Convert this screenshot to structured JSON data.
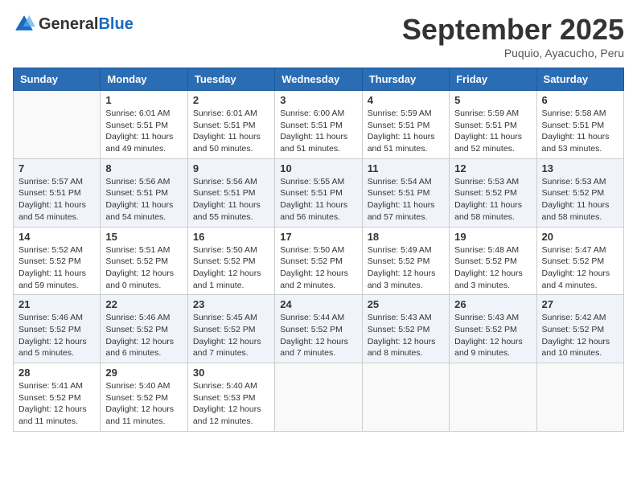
{
  "logo": {
    "general": "General",
    "blue": "Blue"
  },
  "title": "September 2025",
  "location": "Puquio, Ayacucho, Peru",
  "days_of_week": [
    "Sunday",
    "Monday",
    "Tuesday",
    "Wednesday",
    "Thursday",
    "Friday",
    "Saturday"
  ],
  "weeks": [
    [
      {
        "day": "",
        "sunrise": "",
        "sunset": "",
        "daylight": ""
      },
      {
        "day": "1",
        "sunrise": "Sunrise: 6:01 AM",
        "sunset": "Sunset: 5:51 PM",
        "daylight": "Daylight: 11 hours and 49 minutes."
      },
      {
        "day": "2",
        "sunrise": "Sunrise: 6:01 AM",
        "sunset": "Sunset: 5:51 PM",
        "daylight": "Daylight: 11 hours and 50 minutes."
      },
      {
        "day": "3",
        "sunrise": "Sunrise: 6:00 AM",
        "sunset": "Sunset: 5:51 PM",
        "daylight": "Daylight: 11 hours and 51 minutes."
      },
      {
        "day": "4",
        "sunrise": "Sunrise: 5:59 AM",
        "sunset": "Sunset: 5:51 PM",
        "daylight": "Daylight: 11 hours and 51 minutes."
      },
      {
        "day": "5",
        "sunrise": "Sunrise: 5:59 AM",
        "sunset": "Sunset: 5:51 PM",
        "daylight": "Daylight: 11 hours and 52 minutes."
      },
      {
        "day": "6",
        "sunrise": "Sunrise: 5:58 AM",
        "sunset": "Sunset: 5:51 PM",
        "daylight": "Daylight: 11 hours and 53 minutes."
      }
    ],
    [
      {
        "day": "7",
        "sunrise": "Sunrise: 5:57 AM",
        "sunset": "Sunset: 5:51 PM",
        "daylight": "Daylight: 11 hours and 54 minutes."
      },
      {
        "day": "8",
        "sunrise": "Sunrise: 5:56 AM",
        "sunset": "Sunset: 5:51 PM",
        "daylight": "Daylight: 11 hours and 54 minutes."
      },
      {
        "day": "9",
        "sunrise": "Sunrise: 5:56 AM",
        "sunset": "Sunset: 5:51 PM",
        "daylight": "Daylight: 11 hours and 55 minutes."
      },
      {
        "day": "10",
        "sunrise": "Sunrise: 5:55 AM",
        "sunset": "Sunset: 5:51 PM",
        "daylight": "Daylight: 11 hours and 56 minutes."
      },
      {
        "day": "11",
        "sunrise": "Sunrise: 5:54 AM",
        "sunset": "Sunset: 5:51 PM",
        "daylight": "Daylight: 11 hours and 57 minutes."
      },
      {
        "day": "12",
        "sunrise": "Sunrise: 5:53 AM",
        "sunset": "Sunset: 5:52 PM",
        "daylight": "Daylight: 11 hours and 58 minutes."
      },
      {
        "day": "13",
        "sunrise": "Sunrise: 5:53 AM",
        "sunset": "Sunset: 5:52 PM",
        "daylight": "Daylight: 11 hours and 58 minutes."
      }
    ],
    [
      {
        "day": "14",
        "sunrise": "Sunrise: 5:52 AM",
        "sunset": "Sunset: 5:52 PM",
        "daylight": "Daylight: 11 hours and 59 minutes."
      },
      {
        "day": "15",
        "sunrise": "Sunrise: 5:51 AM",
        "sunset": "Sunset: 5:52 PM",
        "daylight": "Daylight: 12 hours and 0 minutes."
      },
      {
        "day": "16",
        "sunrise": "Sunrise: 5:50 AM",
        "sunset": "Sunset: 5:52 PM",
        "daylight": "Daylight: 12 hours and 1 minute."
      },
      {
        "day": "17",
        "sunrise": "Sunrise: 5:50 AM",
        "sunset": "Sunset: 5:52 PM",
        "daylight": "Daylight: 12 hours and 2 minutes."
      },
      {
        "day": "18",
        "sunrise": "Sunrise: 5:49 AM",
        "sunset": "Sunset: 5:52 PM",
        "daylight": "Daylight: 12 hours and 3 minutes."
      },
      {
        "day": "19",
        "sunrise": "Sunrise: 5:48 AM",
        "sunset": "Sunset: 5:52 PM",
        "daylight": "Daylight: 12 hours and 3 minutes."
      },
      {
        "day": "20",
        "sunrise": "Sunrise: 5:47 AM",
        "sunset": "Sunset: 5:52 PM",
        "daylight": "Daylight: 12 hours and 4 minutes."
      }
    ],
    [
      {
        "day": "21",
        "sunrise": "Sunrise: 5:46 AM",
        "sunset": "Sunset: 5:52 PM",
        "daylight": "Daylight: 12 hours and 5 minutes."
      },
      {
        "day": "22",
        "sunrise": "Sunrise: 5:46 AM",
        "sunset": "Sunset: 5:52 PM",
        "daylight": "Daylight: 12 hours and 6 minutes."
      },
      {
        "day": "23",
        "sunrise": "Sunrise: 5:45 AM",
        "sunset": "Sunset: 5:52 PM",
        "daylight": "Daylight: 12 hours and 7 minutes."
      },
      {
        "day": "24",
        "sunrise": "Sunrise: 5:44 AM",
        "sunset": "Sunset: 5:52 PM",
        "daylight": "Daylight: 12 hours and 7 minutes."
      },
      {
        "day": "25",
        "sunrise": "Sunrise: 5:43 AM",
        "sunset": "Sunset: 5:52 PM",
        "daylight": "Daylight: 12 hours and 8 minutes."
      },
      {
        "day": "26",
        "sunrise": "Sunrise: 5:43 AM",
        "sunset": "Sunset: 5:52 PM",
        "daylight": "Daylight: 12 hours and 9 minutes."
      },
      {
        "day": "27",
        "sunrise": "Sunrise: 5:42 AM",
        "sunset": "Sunset: 5:52 PM",
        "daylight": "Daylight: 12 hours and 10 minutes."
      }
    ],
    [
      {
        "day": "28",
        "sunrise": "Sunrise: 5:41 AM",
        "sunset": "Sunset: 5:52 PM",
        "daylight": "Daylight: 12 hours and 11 minutes."
      },
      {
        "day": "29",
        "sunrise": "Sunrise: 5:40 AM",
        "sunset": "Sunset: 5:52 PM",
        "daylight": "Daylight: 12 hours and 11 minutes."
      },
      {
        "day": "30",
        "sunrise": "Sunrise: 5:40 AM",
        "sunset": "Sunset: 5:53 PM",
        "daylight": "Daylight: 12 hours and 12 minutes."
      },
      {
        "day": "",
        "sunrise": "",
        "sunset": "",
        "daylight": ""
      },
      {
        "day": "",
        "sunrise": "",
        "sunset": "",
        "daylight": ""
      },
      {
        "day": "",
        "sunrise": "",
        "sunset": "",
        "daylight": ""
      },
      {
        "day": "",
        "sunrise": "",
        "sunset": "",
        "daylight": ""
      }
    ]
  ]
}
